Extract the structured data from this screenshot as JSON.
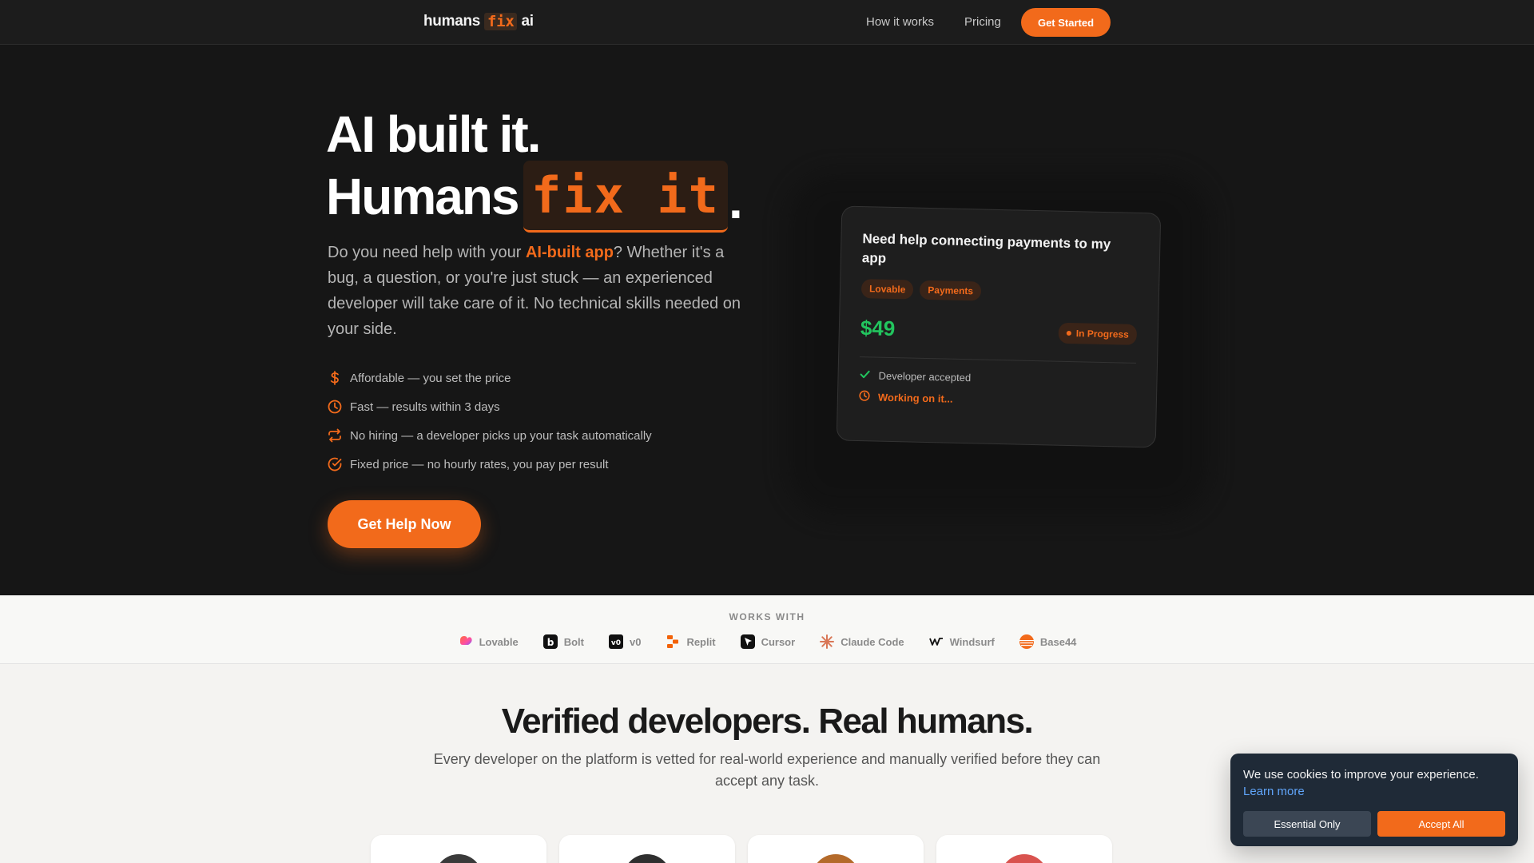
{
  "nav": {
    "logo_prefix": "humans",
    "logo_fix": "fix",
    "logo_suffix": "ai",
    "links": [
      "How it works",
      "Pricing"
    ],
    "cta": "Get Started"
  },
  "hero": {
    "line1": "AI built it.",
    "line2_prefix": "Humans",
    "line2_fix": "fix it",
    "line2_dot": ".",
    "desc_pre": "Do you need help with your ",
    "desc_hl": "AI-built app",
    "desc_post": "? Whether it's a bug, a question, or you're just stuck — an experienced developer will take care of it. No technical skills needed on your side.",
    "features": [
      {
        "icon": "dollar-icon",
        "text": "Affordable — you set the price"
      },
      {
        "icon": "clock-icon",
        "text": "Fast — results within 3 days"
      },
      {
        "icon": "repeat-icon",
        "text": "No hiring — a developer picks up your task automatically"
      },
      {
        "icon": "check-circle-icon",
        "text": "Fixed price — no hourly rates, you pay per result"
      }
    ],
    "cta": "Get Help Now"
  },
  "task_card": {
    "title": "Need help connecting payments to my app",
    "tags": [
      "Lovable",
      "Payments"
    ],
    "price": "$49",
    "status": "In Progress",
    "steps": [
      {
        "icon": "check-icon",
        "text": "Developer accepted"
      },
      {
        "icon": "clock-icon",
        "text": "Working on it..."
      }
    ]
  },
  "works_with": {
    "title": "WORKS WITH",
    "tools": [
      {
        "name": "Lovable",
        "icon": "lovable-icon"
      },
      {
        "name": "Bolt",
        "icon": "bolt-icon"
      },
      {
        "name": "v0",
        "icon": "v0-icon"
      },
      {
        "name": "Replit",
        "icon": "replit-icon"
      },
      {
        "name": "Cursor",
        "icon": "cursor-icon"
      },
      {
        "name": "Claude Code",
        "icon": "claude-icon"
      },
      {
        "name": "Windsurf",
        "icon": "windsurf-icon"
      },
      {
        "name": "Base44",
        "icon": "base44-icon"
      }
    ]
  },
  "verified": {
    "title": "Verified developers. Real humans.",
    "subtitle": "Every developer on the platform is vetted for real-world experience and manually verified before they can accept any task."
  },
  "cookie": {
    "text": "We use cookies to improve your experience.",
    "link": "Learn more",
    "essential": "Essential Only",
    "accept": "Accept All"
  },
  "colors": {
    "accent": "#f26a1b",
    "success": "#22c55e",
    "dark_bg": "#161616"
  }
}
